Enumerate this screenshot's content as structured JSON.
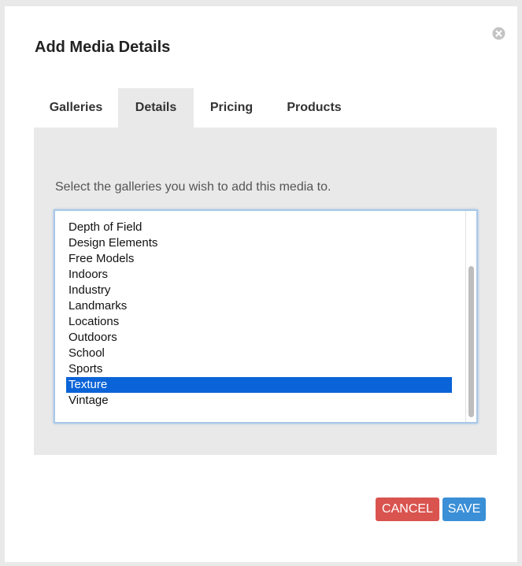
{
  "dialog": {
    "title": "Add Media Details"
  },
  "tabs": [
    {
      "label": "Galleries",
      "active": false
    },
    {
      "label": "Details",
      "active": true
    },
    {
      "label": "Pricing",
      "active": false
    },
    {
      "label": "Products",
      "active": false
    }
  ],
  "galleries": {
    "instructions": "Select the galleries you wish to add this media to.",
    "items": [
      "Depth of Field",
      "Design Elements",
      "Free Models",
      "Indoors",
      "Industry",
      "Landmarks",
      "Locations",
      "Outdoors",
      "School",
      "Sports",
      "Texture",
      "Vintage"
    ],
    "selected": "Texture"
  },
  "buttons": {
    "cancel_label": "CANCEL",
    "save_label": "SAVE"
  },
  "colors": {
    "cancel": "#d9534f",
    "save": "#3a8fd6",
    "selection": "#0a64d8",
    "panel": "#e9e9e9"
  },
  "icons": {
    "close": "close-icon"
  }
}
